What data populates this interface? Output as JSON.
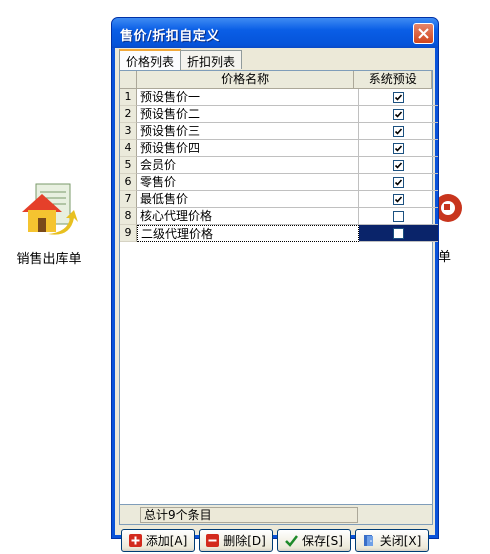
{
  "desktop": {
    "left_icon_label": "销售出库单",
    "right_icon_label": "单"
  },
  "window": {
    "title": "售价/折扣自定义",
    "tabs": [
      {
        "label": "价格列表",
        "active": true
      },
      {
        "label": "折扣列表",
        "active": false
      }
    ],
    "grid": {
      "columns": [
        "价格名称",
        "系统预设"
      ],
      "rows": [
        {
          "num": "1",
          "name": "预设售价一",
          "preset": true
        },
        {
          "num": "2",
          "name": "预设售价二",
          "preset": true
        },
        {
          "num": "3",
          "name": "预设售价三",
          "preset": true
        },
        {
          "num": "4",
          "name": "预设售价四",
          "preset": true
        },
        {
          "num": "5",
          "name": "会员价",
          "preset": true
        },
        {
          "num": "6",
          "name": "零售价",
          "preset": true
        },
        {
          "num": "7",
          "name": "最低售价",
          "preset": true
        },
        {
          "num": "8",
          "name": "核心代理价格",
          "preset": false
        },
        {
          "num": "9",
          "name": "二级代理价格",
          "preset": false
        }
      ]
    },
    "status": "总计9个条目",
    "buttons": {
      "add": "添加[A]",
      "delete": "删除[D]",
      "save": "保存[S]",
      "close": "关闭[X]"
    }
  },
  "colors": {
    "titlebar": "#0553d9",
    "selection": "#0a246a",
    "tab_accent": "#f2a93a"
  }
}
